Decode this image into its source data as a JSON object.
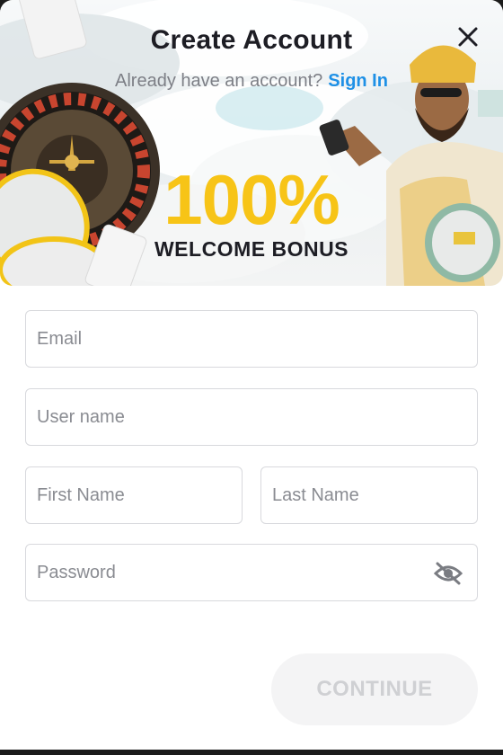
{
  "header": {
    "title": "Create Account",
    "signin_prompt": "Already have an account?",
    "signin_link": "Sign In"
  },
  "banner": {
    "bonus_percent": "100%",
    "bonus_label": "WELCOME BONUS"
  },
  "form": {
    "email_placeholder": "Email",
    "username_placeholder": "User name",
    "first_name_placeholder": "First Name",
    "last_name_placeholder": "Last Name",
    "password_placeholder": "Password",
    "continue_label": "CONTINUE"
  },
  "colors": {
    "accent_blue": "#1e90e6",
    "bonus_yellow": "#f7c417",
    "text_dark": "#1d1d24"
  },
  "icons": [
    "close-icon",
    "eye-off-icon"
  ]
}
